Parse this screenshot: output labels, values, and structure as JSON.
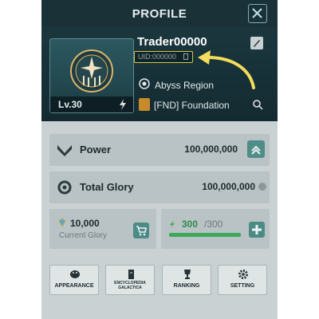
{
  "header": {
    "title": "PROFILE"
  },
  "player": {
    "name": "Trader00000",
    "uid": "UID:000000",
    "level": "Lv.30",
    "region": "Abyss Region",
    "faction": "[FND] Foundation"
  },
  "stats": {
    "power_label": "Power",
    "power_value": "100,000,000",
    "glory_label": "Total Glory",
    "glory_value": "100,000,000"
  },
  "currency": {
    "glory_amount": "10,000",
    "glory_label": "Current Glory",
    "energy_current": "300",
    "energy_max": "/300",
    "energy_fill_fraction": 1.0
  },
  "buttons": {
    "appearance": "APPEARANCE",
    "encyclopedia_line1": "ENCYCLOPEDIA",
    "encyclopedia_line2": "GALACTICA",
    "ranking": "RANKING",
    "setting": "SETTING"
  },
  "colors": {
    "header_bg": "#173138",
    "panel_bg": "#c9d1d3",
    "uid_highlight": "#d7c250",
    "accent_teal": "#4c8a86",
    "energy_green": "#3ea85a",
    "faction_orange": "#c98a2c"
  },
  "icons": {
    "close": "close-icon",
    "rename": "pencil-icon",
    "copy": "copy-icon",
    "region": "planet-icon",
    "faction": "faction-emblem-icon",
    "search": "search-icon",
    "power": "power-chevron-icon",
    "glory": "gear-emblem-icon",
    "gem": "gem-icon",
    "cart": "cart-icon",
    "energy": "energy-icon",
    "plus": "plus-icon",
    "appearance": "palette-icon",
    "encyclopedia": "book-icon",
    "ranking": "trophy-icon",
    "setting": "gear-icon"
  }
}
